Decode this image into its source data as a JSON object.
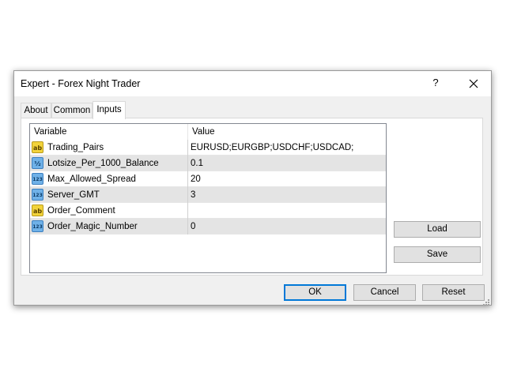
{
  "window": {
    "title": "Expert - Forex Night Trader",
    "help_label": "?",
    "close_icon": "close-icon"
  },
  "tabs": [
    {
      "label": "About",
      "active": false
    },
    {
      "label": "Common",
      "active": false
    },
    {
      "label": "Inputs",
      "active": true
    }
  ],
  "grid": {
    "columns": [
      "Variable",
      "Value"
    ],
    "rows": [
      {
        "variable": "Trading_Pairs",
        "value": "EURUSD;EURGBP;USDCHF;USDCAD;",
        "icon": "string-icon",
        "icon_text": "ab"
      },
      {
        "variable": "Lotsize_Per_1000_Balance",
        "value": "0.1",
        "icon": "double-icon",
        "icon_text": "½"
      },
      {
        "variable": "Max_Allowed_Spread",
        "value": "20",
        "icon": "integer-icon",
        "icon_text": "123"
      },
      {
        "variable": "Server_GMT",
        "value": "3",
        "icon": "integer-icon",
        "icon_text": "123"
      },
      {
        "variable": "Order_Comment",
        "value": "",
        "icon": "string-icon",
        "icon_text": "ab"
      },
      {
        "variable": "Order_Magic_Number",
        "value": "0",
        "icon": "integer-icon",
        "icon_text": "123"
      }
    ]
  },
  "buttons": {
    "load": "Load",
    "save": "Save",
    "ok": "OK",
    "cancel": "Cancel",
    "reset": "Reset"
  },
  "colors": {
    "string_icon_bg": "#f2d33b",
    "numeric_icon_bg": "#6fb1e8",
    "default_button_border": "#0078d7"
  }
}
